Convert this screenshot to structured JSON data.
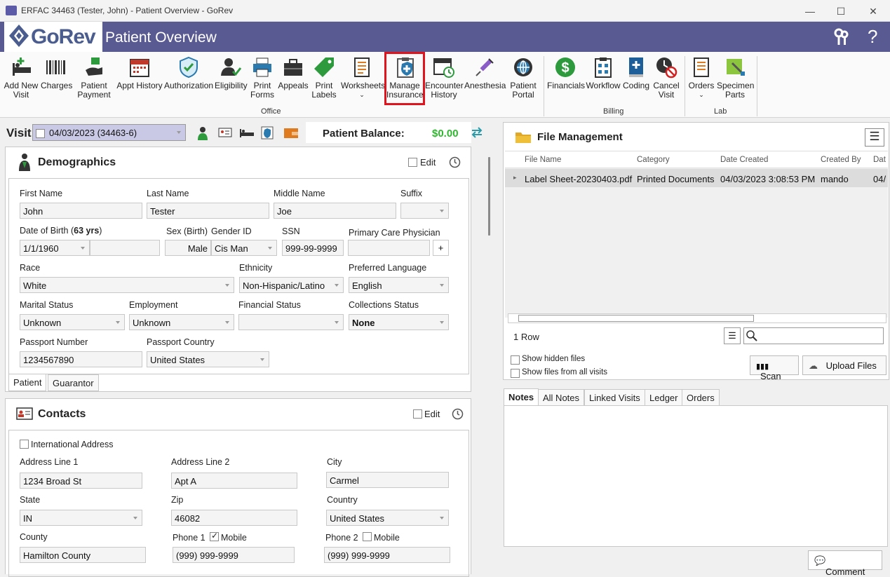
{
  "window": {
    "title": "ERFAC 34463 (Tester, John) - Patient Overview - GoRev",
    "minimize": "—",
    "maximize": "☐",
    "close": "✕"
  },
  "header": {
    "logo_text": "GoRev",
    "title": "Patient Overview",
    "help": "?"
  },
  "toolbar": {
    "add_new_visit": "Add New\nVisit",
    "charges": "Charges",
    "patient_payment": "Patient\nPayment",
    "appt_history": "Appt History",
    "authorization": "Authorization",
    "eligibility": "Eligibility",
    "print_forms": "Print\nForms",
    "appeals": "Appeals",
    "print_labels": "Print\nLabels",
    "worksheets": "Worksheets",
    "manage_insurance": "Manage\nInsurance",
    "encounter_history": "Encounter\nHistory",
    "anesthesia": "Anesthesia",
    "patient_portal": "Patient\nPortal",
    "financials": "Financials",
    "workflow": "Workflow",
    "coding": "Coding",
    "cancel_visit": "Cancel\nVisit",
    "orders": "Orders",
    "specimen_parts": "Specimen\nParts",
    "group_office": "Office",
    "group_billing": "Billing",
    "group_lab": "Lab"
  },
  "visitbar": {
    "label": "Visit",
    "visit_value": "04/03/2023 (34463-6)",
    "balance_label": "Patient Balance:",
    "balance_value": "$0.00"
  },
  "demographics": {
    "title": "Demographics",
    "edit": "Edit",
    "first_name_label": "First Name",
    "first_name": "John",
    "last_name_label": "Last Name",
    "last_name": "Tester",
    "middle_name_label": "Middle Name",
    "middle_name": "Joe",
    "suffix_label": "Suffix",
    "dob_label": "Date of Birth (",
    "dob_age": "63 yrs",
    "dob_close": ")",
    "dob": "1/1/1960",
    "sex_label": "Sex (Birth)",
    "sex": "Male",
    "gender_label": "Gender ID",
    "gender": "Cis Man",
    "ssn_label": "SSN",
    "ssn": "999-99-9999",
    "pcp_label": "Primary Care Physician",
    "pcp_add": "+",
    "race_label": "Race",
    "race": "White",
    "ethnicity_label": "Ethnicity",
    "ethnicity": "Non-Hispanic/Latino",
    "language_label": "Preferred Language",
    "language": "English",
    "marital_label": "Marital Status",
    "marital": "Unknown",
    "employment_label": "Employment",
    "employment": "Unknown",
    "financial_label": "Financial Status",
    "collections_label": "Collections Status",
    "collections": "None",
    "passport_label": "Passport Number",
    "passport": "1234567890",
    "passport_country_label": "Passport Country",
    "passport_country": "United States",
    "tab_patient": "Patient",
    "tab_guarantor": "Guarantor"
  },
  "contacts": {
    "title": "Contacts",
    "edit": "Edit",
    "intl": "International Address",
    "addr1_label": "Address Line 1",
    "addr1": "1234 Broad St",
    "addr2_label": "Address Line 2",
    "addr2": "Apt A",
    "city_label": "City",
    "city": "Carmel",
    "state_label": "State",
    "state": "IN",
    "zip_label": "Zip",
    "zip": "46082",
    "country_label": "Country",
    "country": "United States",
    "county_label": "County",
    "county": "Hamilton County",
    "phone1_label": "Phone 1",
    "mobile1": "Mobile",
    "phone1": "(999) 999-9999",
    "phone2_label": "Phone 2",
    "mobile2": "Mobile",
    "phone2": "(999) 999-9999"
  },
  "files": {
    "title": "File Management",
    "col_name": "File Name",
    "col_category": "Category",
    "col_date": "Date Created",
    "col_by": "Created By",
    "col_more": "Dat",
    "row_name": "Label Sheet-20230403.pdf",
    "row_category": "Printed Documents",
    "row_date": "04/03/2023 3:08:53 PM",
    "row_by": "mando",
    "row_more": "04/",
    "row_count": "1 Row",
    "show_hidden": "Show hidden files",
    "show_all": "Show files from all visits",
    "scan": "Scan",
    "upload": "Upload Files"
  },
  "notes": {
    "tab_notes": "Notes",
    "tab_all": "All Notes",
    "tab_linked": "Linked Visits",
    "tab_ledger": "Ledger",
    "tab_orders": "Orders",
    "comment": "Comment"
  }
}
